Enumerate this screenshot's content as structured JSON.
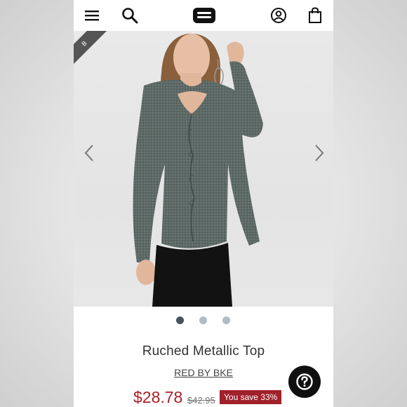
{
  "header": {
    "icons": [
      "menu-icon",
      "search-icon",
      "logo",
      "account-icon",
      "cart-icon"
    ]
  },
  "hero": {
    "badge_text": "B",
    "carousel": {
      "slide_count": 3,
      "active_index": 0
    }
  },
  "product": {
    "title": "Ruched Metallic Top",
    "brand": "RED BY BKE",
    "price": "$28.78",
    "original_price": "$42.95",
    "savings": "You save 33%"
  },
  "colors": {
    "price": "#a8202a",
    "savings_badge": "#a0202b",
    "active_dot": "#4b525a",
    "inactive_dot": "#b4bac0",
    "help_button": "#101010"
  }
}
